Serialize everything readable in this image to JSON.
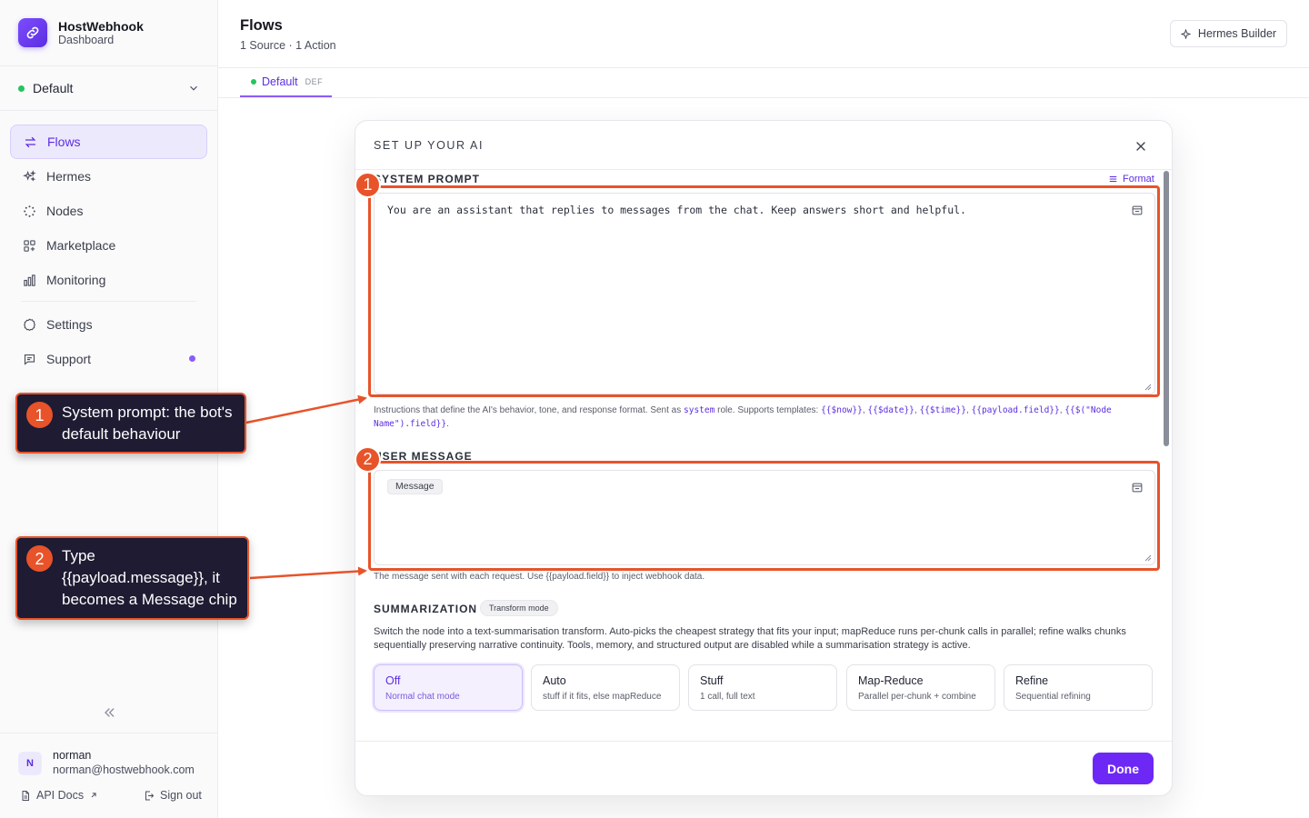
{
  "brand": {
    "name": "HostWebhook",
    "subtitle": "Dashboard"
  },
  "workspace": {
    "name": "Default",
    "status_color": "#22c55e"
  },
  "nav": {
    "items": [
      {
        "label": "Flows",
        "icon": "arrows-swap-icon",
        "active": true
      },
      {
        "label": "Hermes",
        "icon": "sparkles-icon"
      },
      {
        "label": "Nodes",
        "icon": "dots-circle-icon"
      },
      {
        "label": "Marketplace",
        "icon": "grid-plus-icon"
      },
      {
        "label": "Monitoring",
        "icon": "bar-chart-icon"
      }
    ],
    "secondary": [
      {
        "label": "Settings",
        "icon": "gear-icon"
      },
      {
        "label": "Support",
        "icon": "chat-icon",
        "badge": true
      }
    ]
  },
  "user": {
    "initial": "N",
    "name": "norman",
    "email": "norman@hostwebhook.com"
  },
  "footer": {
    "api_docs": "API Docs",
    "sign_out": "Sign out"
  },
  "header": {
    "title": "Flows",
    "subtitle": "1 Source · 1 Action",
    "builder_button": "Hermes Builder"
  },
  "tabs": [
    {
      "label": "Default",
      "badge": "DEF"
    }
  ],
  "modal": {
    "title": "SET UP YOUR AI",
    "system_prompt": {
      "label": "SYSTEM PROMPT",
      "format_link": "Format",
      "value": "You are an assistant that replies to messages from the chat. Keep answers short and helpful.",
      "help_prefix": "Instructions that define the AI's behavior, tone, and response format. Sent as",
      "help_role": "system",
      "help_mid": "role. Supports templates:",
      "templates": [
        "{{$now}}",
        "{{$date}}",
        "{{$time}}",
        "{{payload.field}}",
        "{{$(\"Node Name\").field}}"
      ]
    },
    "user_message": {
      "label": "USER MESSAGE",
      "chip": "Message",
      "help": "The message sent with each request. Use {{payload.field}} to inject webhook data."
    },
    "summarization": {
      "label": "SUMMARIZATION",
      "mode_pill": "Transform mode",
      "description": "Switch the node into a text-summarisation transform. Auto-picks the cheapest strategy that fits your input; mapReduce runs per-chunk calls in parallel; refine walks chunks sequentially preserving narrative continuity. Tools, memory, and structured output are disabled while a summarisation strategy is active.",
      "options": [
        {
          "name": "Off",
          "desc": "Normal chat mode",
          "selected": true
        },
        {
          "name": "Auto",
          "desc": "stuff if it fits, else mapReduce"
        },
        {
          "name": "Stuff",
          "desc": "1 call, full text"
        },
        {
          "name": "Map-Reduce",
          "desc": "Parallel per-chunk + combine"
        },
        {
          "name": "Refine",
          "desc": "Sequential refining"
        }
      ]
    },
    "done_button": "Done"
  },
  "annotations": [
    {
      "number": "1",
      "text": "System prompt: the bot's default behaviour"
    },
    {
      "number": "2",
      "text": "Type {{payload.message}}, it becomes a Message chip"
    }
  ],
  "colors": {
    "accent": "#6d28f5",
    "annotation": "#e8532a",
    "callout_bg": "#1e1b33"
  }
}
